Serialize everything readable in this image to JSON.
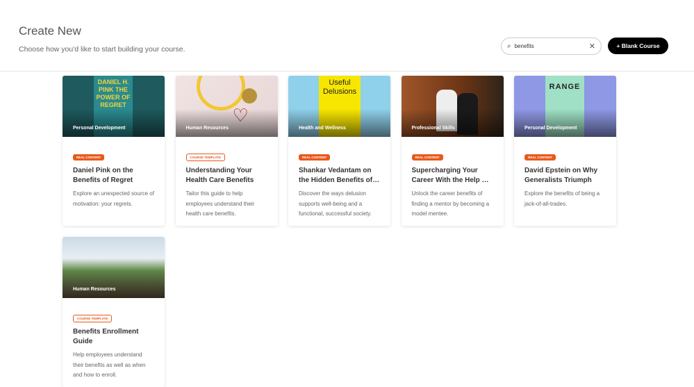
{
  "header": {
    "title": "Create New",
    "subtitle": "Choose how you'd like to start building your course.",
    "search_value": "benefits",
    "blank_course": "+ Blank Course"
  },
  "cards": [
    {
      "category": "Personal Development",
      "badge": "REAL CONTENT",
      "title": "Daniel Pink on the Benefits of Regret",
      "desc": "Explore an unexpected source of motivation: your regrets.",
      "cover": "DANIEL H. PINK THE POWER OF REGRET"
    },
    {
      "category": "Human Resources",
      "badge": "COURSE TEMPLATE",
      "title": "Understanding Your Health Care Benefits",
      "desc": "Tailor this guide to help employees understand their health care benefits."
    },
    {
      "category": "Health and Wellness",
      "badge": "REAL CONTENT",
      "title": "Shankar Vedantam on the Hidden Benefits of…",
      "desc": "Discover the ways delusion supports well-being and a functional, successful society.",
      "cover": "Useful Delusions"
    },
    {
      "category": "Professional Skills",
      "badge": "REAL CONTENT",
      "title": "Supercharging Your Career With the Help …",
      "desc": "Unlock the career benefits of finding a mentor by becoming a model mentee."
    },
    {
      "category": "Personal Development",
      "badge": "REAL CONTENT",
      "title": "David Epstein on Why Generalists Triumph in…",
      "desc": "Explore the benefits of being a jack-of-all-trades.",
      "cover": "RANGE"
    },
    {
      "category": "Human Resources",
      "badge": "COURSE TEMPLATE",
      "title": "Benefits Enrollment Guide",
      "desc": "Help employees understand their benefits as well as when and how to enroll."
    }
  ]
}
